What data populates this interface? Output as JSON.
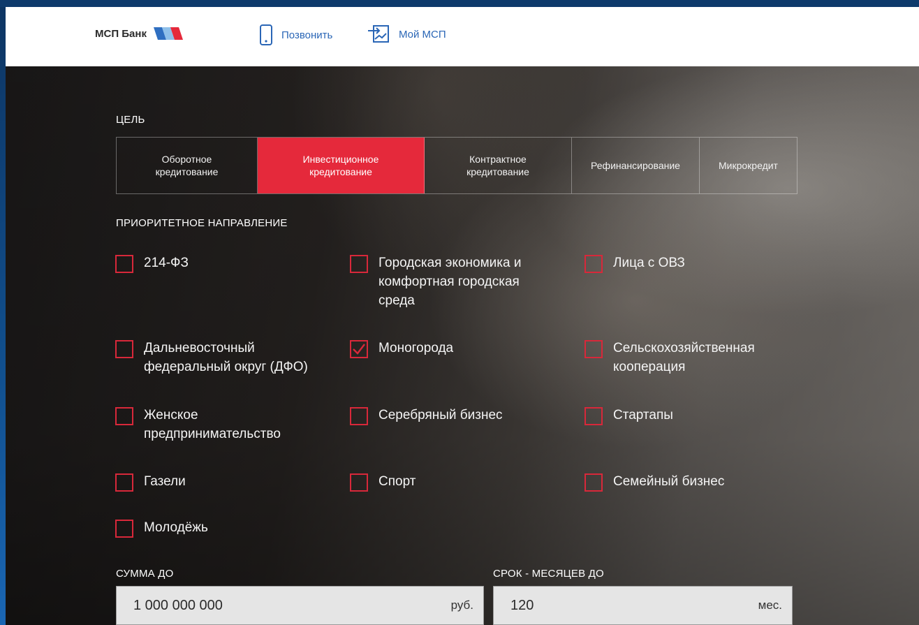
{
  "header": {
    "logo_text": "МСП Банк",
    "nav": [
      {
        "label": "Позвонить",
        "icon": "phone-icon"
      },
      {
        "label": "Мой МСП",
        "icon": "login-icon"
      }
    ]
  },
  "goal": {
    "label": "ЦЕЛЬ",
    "tabs": [
      {
        "label": "Оборотное\nкредитование",
        "active": false
      },
      {
        "label": "Инвестиционное\nкредитование",
        "active": true
      },
      {
        "label": "Контрактное\nкредитование",
        "active": false
      },
      {
        "label": "Рефинансирование",
        "active": false
      },
      {
        "label": "Микрокредит",
        "active": false
      }
    ]
  },
  "priority": {
    "label": "ПРИОРИТЕТНОЕ НАПРАВЛЕНИЕ",
    "items": [
      {
        "label": "214-ФЗ",
        "checked": false
      },
      {
        "label": "Городская экономика и комфортная городская среда",
        "checked": false
      },
      {
        "label": "Лица с ОВЗ",
        "checked": false
      },
      {
        "label": "Дальневосточный федеральный округ (ДФО)",
        "checked": false
      },
      {
        "label": "Моногорода",
        "checked": true
      },
      {
        "label": "Сельскохозяйственная кооперация",
        "checked": false
      },
      {
        "label": "Женское предпринимательство",
        "checked": false
      },
      {
        "label": "Серебряный бизнес",
        "checked": false
      },
      {
        "label": "Стартапы",
        "checked": false
      },
      {
        "label": "Газели",
        "checked": false
      },
      {
        "label": "Спорт",
        "checked": false
      },
      {
        "label": "Семейный бизнес",
        "checked": false
      },
      {
        "label": "Молодёжь",
        "checked": false
      }
    ]
  },
  "amount": {
    "label": "СУММА ДО",
    "value": "1 000 000 000",
    "unit": "руб."
  },
  "term": {
    "label": "СРОК - МЕСЯЦЕВ ДО",
    "value": "120",
    "unit": "мес."
  },
  "colors": {
    "accent": "#e5293b",
    "brand_blue": "#2a66b6",
    "checkbox_border": "#d8283a"
  }
}
